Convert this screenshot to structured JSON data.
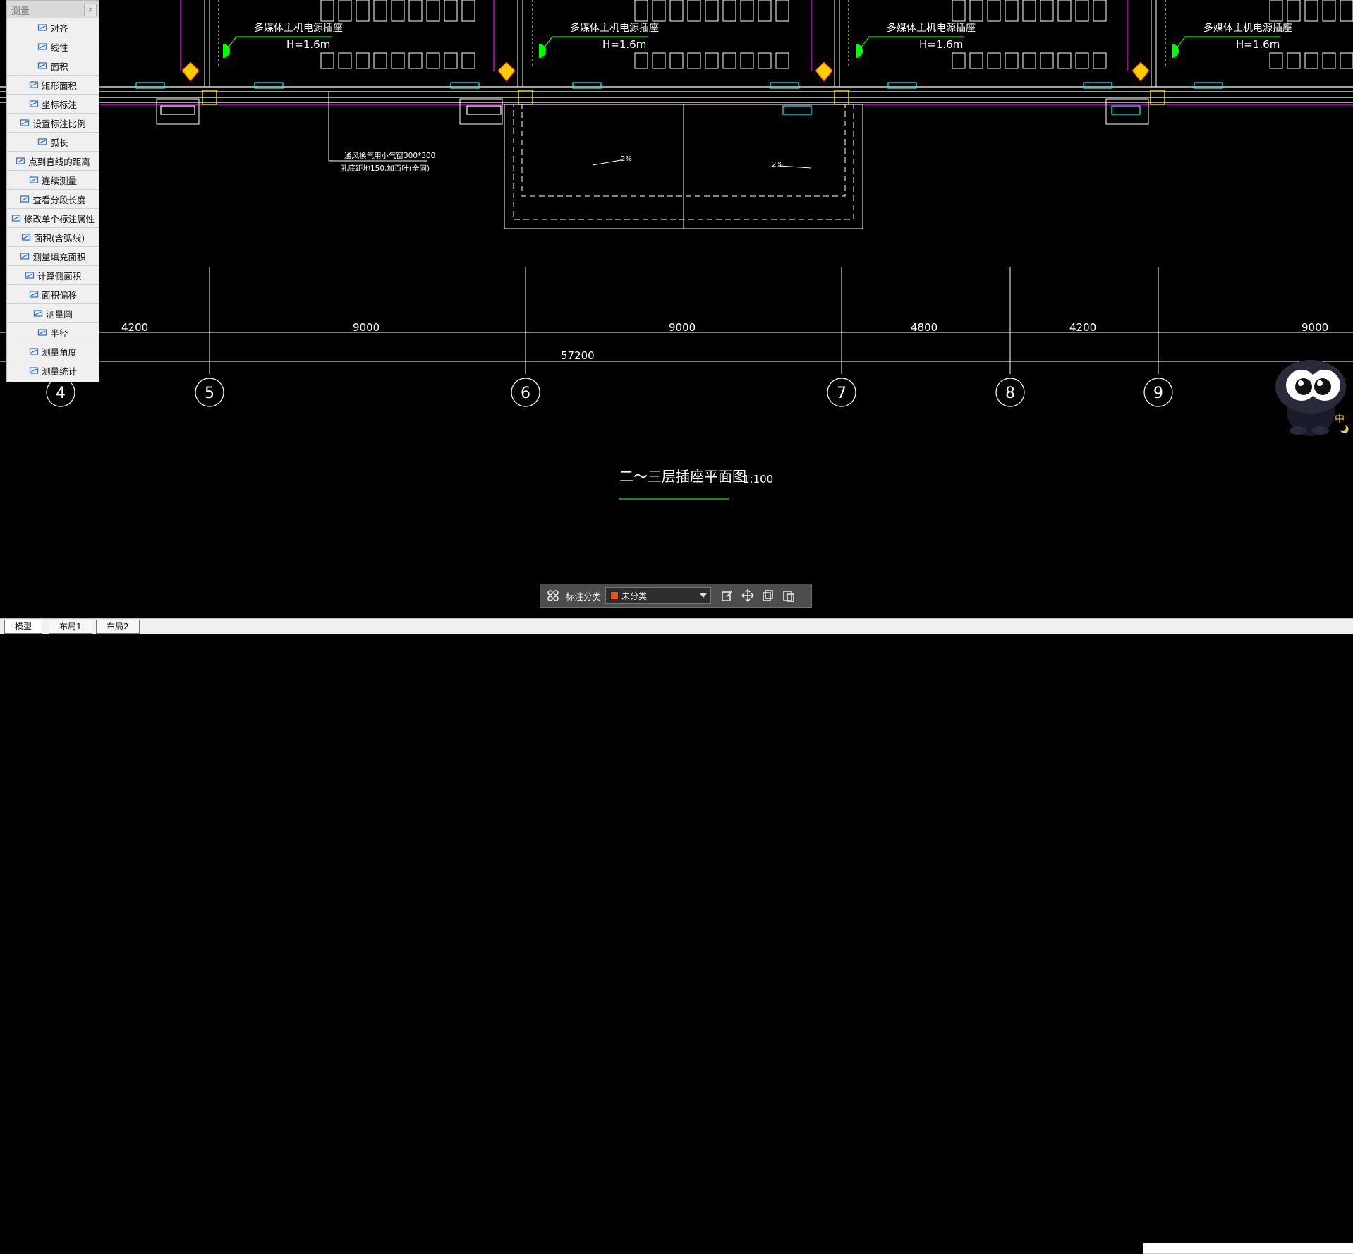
{
  "panel": {
    "title": "测量",
    "close_label": "×",
    "items": [
      {
        "label": "对齐",
        "icon": "align-icon"
      },
      {
        "label": "线性",
        "icon": "linear-dimension-icon"
      },
      {
        "label": "面积",
        "icon": "area-icon"
      },
      {
        "label": "矩形面积",
        "icon": "rect-area-icon"
      },
      {
        "label": "坐标标注",
        "icon": "coordinate-icon"
      },
      {
        "label": "设置标注比例",
        "icon": "scale-icon"
      },
      {
        "label": "弧长",
        "icon": "arc-length-icon"
      },
      {
        "label": "点到直线的距离",
        "icon": "point-line-icon"
      },
      {
        "label": "连续测量",
        "icon": "continuous-measure-icon"
      },
      {
        "label": "查看分段长度",
        "icon": "segment-length-icon"
      },
      {
        "label": "修改单个标注属性",
        "icon": "edit-annotation-icon"
      },
      {
        "label": "面积(含弧线)",
        "icon": "arc-area-icon"
      },
      {
        "label": "测量填充面积",
        "icon": "fill-area-icon"
      },
      {
        "label": "计算侧面积",
        "icon": "side-area-icon"
      },
      {
        "label": "面积偏移",
        "icon": "area-offset-icon"
      },
      {
        "label": "测量圆",
        "icon": "circle-measure-icon"
      },
      {
        "label": "半径",
        "icon": "radius-icon"
      },
      {
        "label": "测量角度",
        "icon": "angle-icon"
      },
      {
        "label": "测量统计",
        "icon": "statistics-icon"
      }
    ]
  },
  "drawing": {
    "socket_label": "多媒体主机电源插座",
    "height_label": "H=1.6m",
    "vent_note_1": "通风换气用小气窗300*300",
    "vent_note_2": "孔底距地150,加百叶(全同)",
    "slope_label": "2%",
    "dimensions": [
      "4200",
      "9000",
      "9000",
      "4800",
      "4200",
      "9000"
    ],
    "total_dimension": "57200",
    "axes": [
      "4",
      "5",
      "6",
      "7",
      "8",
      "9"
    ],
    "title": "二～三层插座平面图",
    "scale": "1:100",
    "colors": {
      "wall": "#ffffff",
      "magenta": "#ff00ff",
      "green": "#00ff00",
      "cyan": "#00ffff",
      "yellow": "#ffff00"
    }
  },
  "toolbar": {
    "grid_icon": "grid-icon",
    "label": "标注分类",
    "category_value": "未分类",
    "icons": [
      "edit-icon",
      "move-icon",
      "copy-icon",
      "paste-icon"
    ]
  },
  "tabs": [
    "模型",
    "布局1",
    "布局2"
  ],
  "mascot": {
    "badge": "中"
  }
}
